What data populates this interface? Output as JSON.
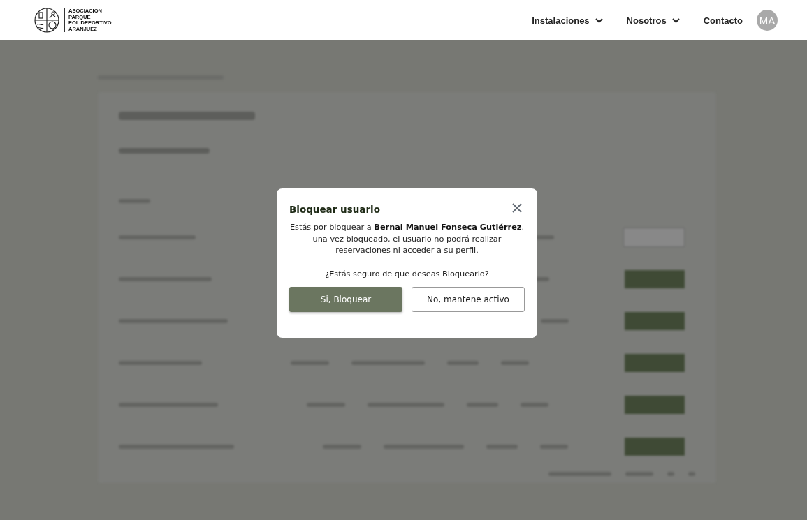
{
  "header": {
    "logo_lines": [
      "ASOCIACION",
      "PARQUE",
      "POLIDEPORTIVO",
      "ARANJUEZ"
    ],
    "nav": [
      {
        "label": "Instalaciones",
        "kind": "dropdown"
      },
      {
        "label": "Nosotros",
        "kind": "dropdown"
      },
      {
        "label": "Contacto",
        "kind": "link"
      }
    ],
    "avatar": "MA"
  },
  "dialog": {
    "title": "Bloquear usuario",
    "message": "Estás por bloquear a **Bernal Manuel Fonseca Gutiérrez**, una vez bloqueado, el usuario no podrá realizar reservaciones ni acceder a su perfil.",
    "question": "¿Estás seguro de que deseas Bloquearlo?",
    "buttons": [
      {
        "label": "Si, Bloquear",
        "kind": "primary"
      },
      {
        "label": "No, mantene activo",
        "kind": "secondary"
      }
    ]
  }
}
